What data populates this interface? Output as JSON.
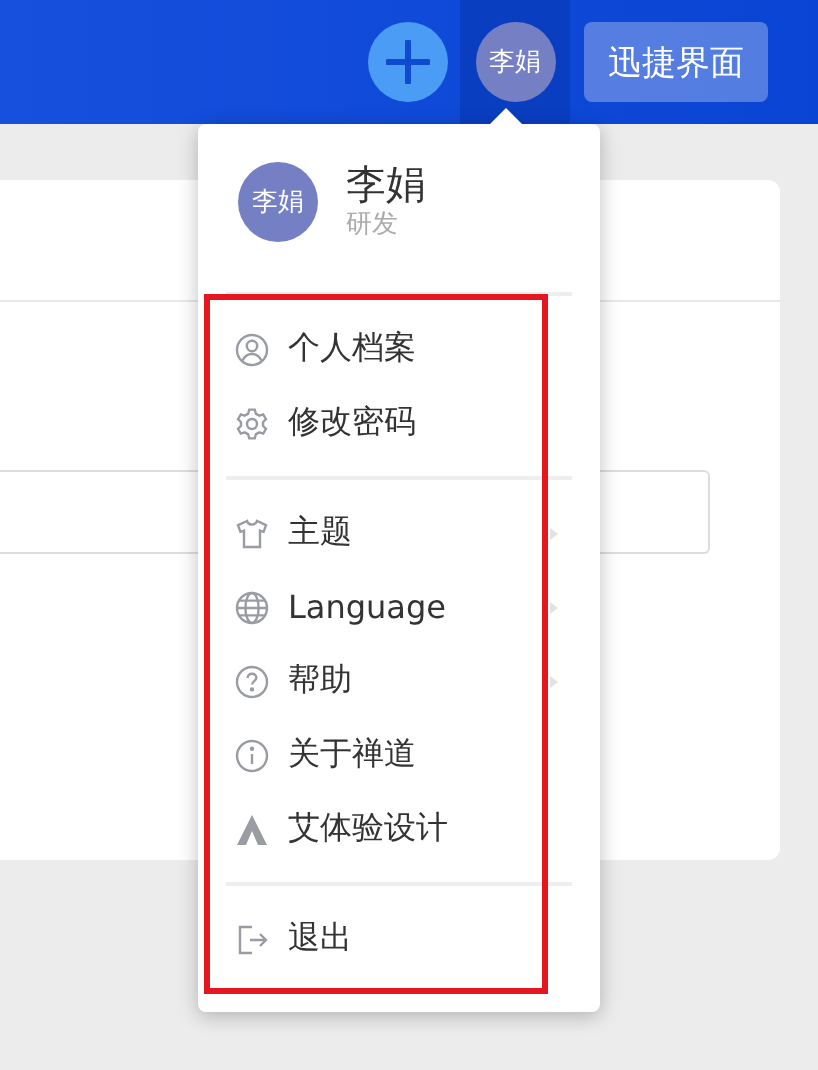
{
  "top_bar": {
    "user_avatar": "李娟",
    "quick_button": "迅捷界面"
  },
  "user_menu": {
    "avatar": "李娟",
    "name": "李娟",
    "role": "研发",
    "sections": [
      {
        "items": [
          {
            "kind": "profile",
            "label": "个人档案",
            "has_submenu": false
          },
          {
            "kind": "password",
            "label": "修改密码",
            "has_submenu": false
          }
        ]
      },
      {
        "items": [
          {
            "kind": "theme",
            "label": "主题",
            "has_submenu": true
          },
          {
            "kind": "language",
            "label": "Language",
            "has_submenu": true
          },
          {
            "kind": "help",
            "label": "帮助",
            "has_submenu": true
          },
          {
            "kind": "about",
            "label": "关于禅道",
            "has_submenu": false
          },
          {
            "kind": "brand",
            "label": "艾体验设计",
            "has_submenu": false
          }
        ]
      },
      {
        "items": [
          {
            "kind": "logout",
            "label": "退出",
            "has_submenu": false
          }
        ]
      }
    ]
  }
}
